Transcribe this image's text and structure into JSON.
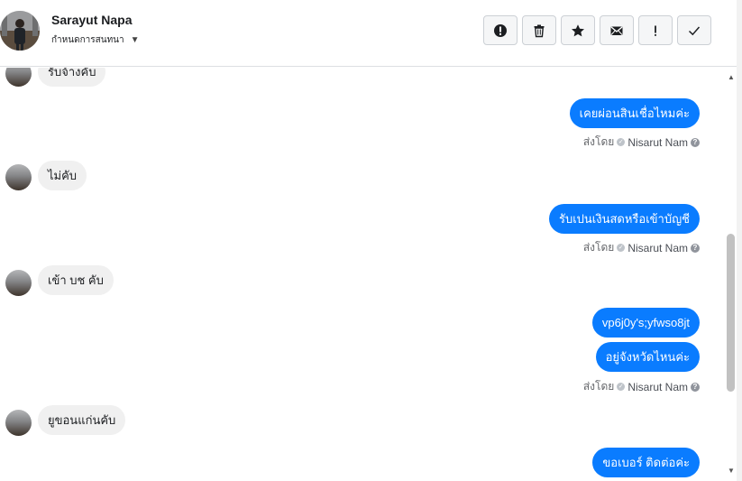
{
  "header": {
    "name": "Sarayut Napa",
    "subtitle": "กำหนดการสนทนา"
  },
  "actions": [
    {
      "name": "report-icon",
      "glyph": "!"
    },
    {
      "name": "trash-icon",
      "glyph": "trash"
    },
    {
      "name": "star-icon",
      "glyph": "★"
    },
    {
      "name": "mail-icon",
      "glyph": "mail"
    },
    {
      "name": "important-icon",
      "glyph": "!"
    },
    {
      "name": "check-icon",
      "glyph": "✓"
    }
  ],
  "messages": {
    "m1": "รับจ้างคับ",
    "m2": "เคยผ่อนสินเชื่อไหมค่ะ",
    "m3": "ไม่คับ",
    "m4": "รับเปนเงินสดหรือเข้าบัญชี",
    "m5": "เข้า บช คับ",
    "m6": "vp6j0y's;yfwso8jt",
    "m7": "อยู่จังหวัดไหนค่ะ",
    "m8": "ยูขอนแก่นคับ",
    "m9": "ขอเบอร์ ติดต่อค่ะ"
  },
  "sent_by": {
    "prefix": "ส่งโดย",
    "agent": "Nisarut Nam"
  },
  "colors": {
    "outgoing": "#0a7cff",
    "incoming": "#f0f0f0"
  }
}
